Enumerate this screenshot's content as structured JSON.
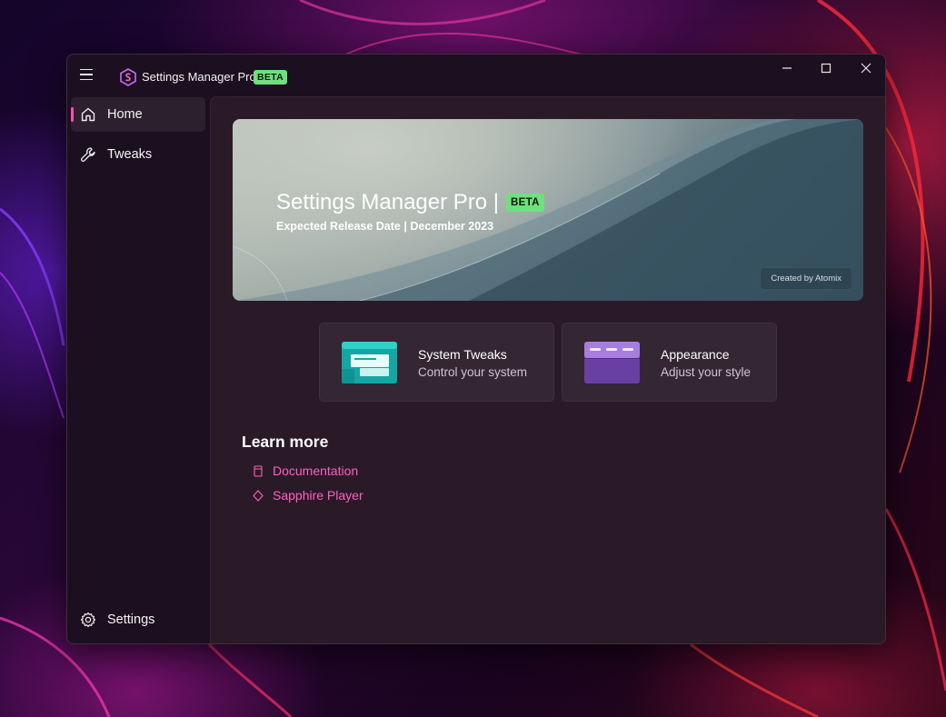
{
  "app": {
    "title": "Settings Manager Pro",
    "badge": "BETA",
    "accent": "#ff4fb5",
    "badge_color": "#6fe07e"
  },
  "window_controls": [
    "minimize-icon",
    "maximize-icon",
    "close-icon"
  ],
  "sidebar": {
    "items": [
      {
        "label": "Home",
        "icon": "home-icon",
        "active": true
      },
      {
        "label": "Tweaks",
        "icon": "wrench-icon",
        "active": false
      }
    ],
    "footer": {
      "label": "Settings",
      "icon": "gear-icon"
    }
  },
  "hero": {
    "title": "Settings Manager Pro |",
    "badge": "BETA",
    "subtitle": "Expected Release Date | December 2023",
    "credit": "Created by Atomix"
  },
  "cards": [
    {
      "title": "System Tweaks",
      "description": "Control your system",
      "icon": "system-tweaks-icon"
    },
    {
      "title": "Appearance",
      "description": "Adjust your style",
      "icon": "appearance-icon"
    }
  ],
  "learn_more": {
    "heading": "Learn more",
    "links": [
      {
        "label": "Documentation",
        "icon": "document-icon"
      },
      {
        "label": "Sapphire Player",
        "icon": "diamond-icon"
      }
    ]
  }
}
